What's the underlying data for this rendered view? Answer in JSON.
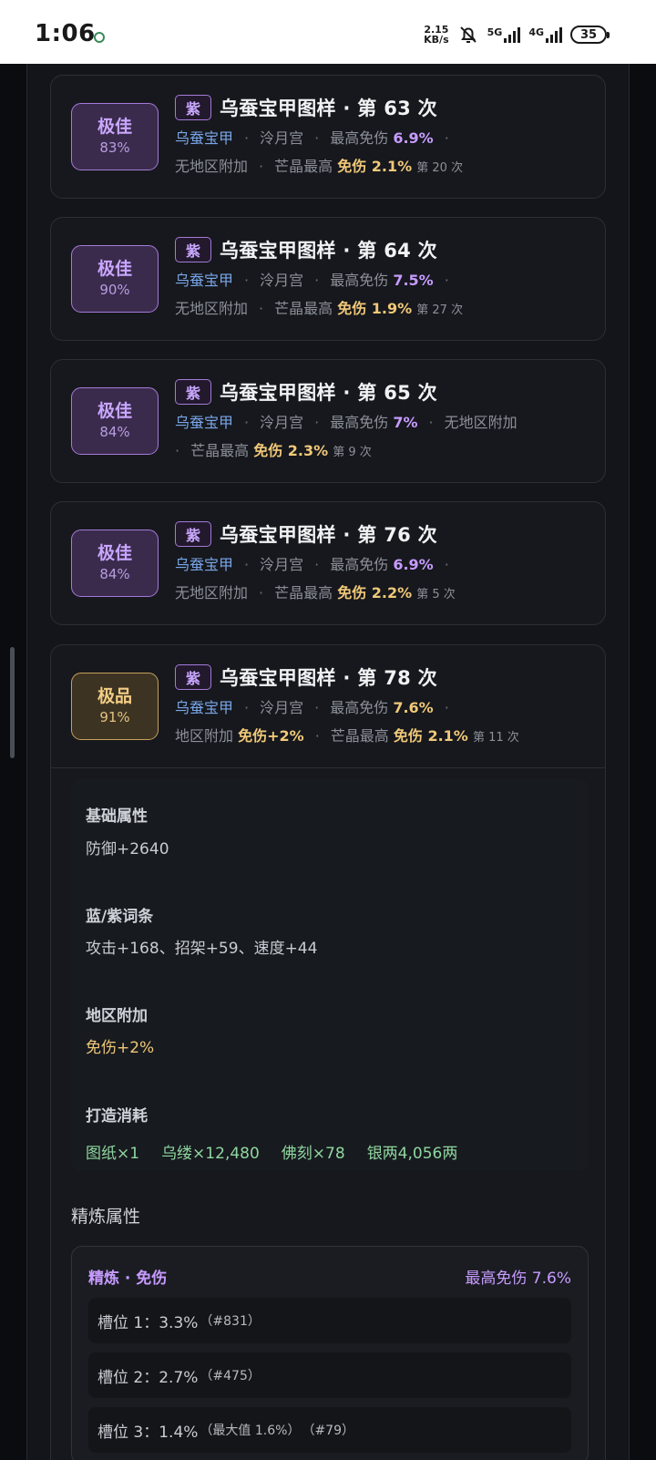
{
  "status_bar": {
    "time": "1:06",
    "speed_value": "2.15",
    "speed_unit": "KB/s",
    "net1": "5G",
    "net2": "4G",
    "battery": "35"
  },
  "cards": [
    {
      "badge_label": "极佳",
      "badge_pct": "83%",
      "badge_color": "purple",
      "tag": "紫",
      "title": "乌蚕宝甲图样 · 第 63 次",
      "meta_line1": {
        "item": "乌蚕宝甲",
        "place": "泠月宫",
        "max_label": "最高免伤",
        "max_value": "6.9%"
      },
      "meta_line2": {
        "region": "无地区附加",
        "crystal_label": "芒晶最高",
        "crystal_value": "免伤 2.1%",
        "crystal_count": "第 20 次"
      }
    },
    {
      "badge_label": "极佳",
      "badge_pct": "90%",
      "badge_color": "purple",
      "tag": "紫",
      "title": "乌蚕宝甲图样 · 第 64 次",
      "meta_line1": {
        "item": "乌蚕宝甲",
        "place": "泠月宫",
        "max_label": "最高免伤",
        "max_value": "7.5%"
      },
      "meta_line2": {
        "region": "无地区附加",
        "crystal_label": "芒晶最高",
        "crystal_value": "免伤 1.9%",
        "crystal_count": "第 27 次"
      }
    },
    {
      "badge_label": "极佳",
      "badge_pct": "84%",
      "badge_color": "purple",
      "tag": "紫",
      "title": "乌蚕宝甲图样 · 第 65 次",
      "meta_line1": {
        "item": "乌蚕宝甲",
        "place": "泠月宫",
        "max_label": "最高免伤",
        "max_value": "7%",
        "region": "无地区附加"
      },
      "meta_line2": {
        "crystal_label": "芒晶最高",
        "crystal_value": "免伤 2.3%",
        "crystal_count": "第 9 次"
      }
    },
    {
      "badge_label": "极佳",
      "badge_pct": "84%",
      "badge_color": "purple",
      "tag": "紫",
      "title": "乌蚕宝甲图样 · 第 76 次",
      "meta_line1": {
        "item": "乌蚕宝甲",
        "place": "泠月宫",
        "max_label": "最高免伤",
        "max_value": "6.9%"
      },
      "meta_line2": {
        "region": "无地区附加",
        "crystal_label": "芒晶最高",
        "crystal_value": "免伤 2.2%",
        "crystal_count": "第 5 次"
      }
    },
    {
      "badge_label": "极品",
      "badge_pct": "91%",
      "badge_color": "gold",
      "tag": "紫",
      "title": "乌蚕宝甲图样 · 第 78 次",
      "meta_line1": {
        "item": "乌蚕宝甲",
        "place": "泠月宫",
        "max_label": "最高免伤",
        "max_value": "7.6%"
      },
      "meta_line2": {
        "region_label": "地区附加",
        "region_value": "免伤+2%",
        "crystal_label": "芒晶最高",
        "crystal_value": "免伤 2.1%",
        "crystal_count": "第 11 次"
      }
    }
  ],
  "detail": {
    "base_title": "基础属性",
    "base_value": "防御+2640",
    "affix_title": "蓝/紫词条",
    "affix_value": "攻击+168、招架+59、速度+44",
    "region_title": "地区附加",
    "region_value": "免伤+2%",
    "cost_title": "打造消耗",
    "costs": [
      "图纸×1",
      "乌缕×12,480",
      "佛刻×78",
      "银两4,056两"
    ]
  },
  "refine": {
    "heading": "精炼属性",
    "box_title": "精炼 · 免伤",
    "box_right": "最高免伤 7.6%",
    "slots": [
      {
        "label": "槽位 1：3.3%",
        "extra": "",
        "id": "（#831）"
      },
      {
        "label": "槽位 2：2.7%",
        "extra": "",
        "id": "（#475）"
      },
      {
        "label": "槽位 3：1.4%",
        "extra": "（最大值 1.6%）",
        "id": "（#79）"
      }
    ]
  }
}
